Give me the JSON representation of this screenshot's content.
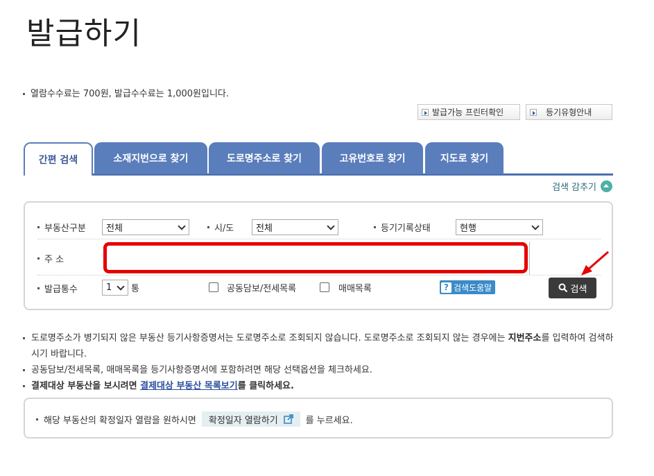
{
  "page": {
    "title": "발급하기"
  },
  "fee_note": "열람수수료는 700원, 발급수수료는 1,000원입니다.",
  "top_buttons": {
    "printer_check": "발급가능 프린터확인",
    "registry_type_guide": "등기유형안내"
  },
  "tabs": [
    {
      "label": "간편 검색",
      "active": true
    },
    {
      "label": "소재지번으로 찾기",
      "active": false
    },
    {
      "label": "도로명주소로 찾기",
      "active": false
    },
    {
      "label": "고유번호로 찾기",
      "active": false
    },
    {
      "label": "지도로 찾기",
      "active": false
    }
  ],
  "collapse_search": "검색 감추기",
  "form": {
    "property_type": {
      "label": "부동산구분",
      "value": "전체"
    },
    "region": {
      "label": "시/도",
      "value": "전체"
    },
    "record_status": {
      "label": "등기기록상태",
      "value": "현행"
    },
    "address": {
      "label": "주 소",
      "value": ""
    },
    "copies": {
      "label": "발급통수",
      "value": "1",
      "unit": "통"
    },
    "joint_collateral": {
      "label": "공동담보/전세목록",
      "checked": false
    },
    "sales_list": {
      "label": "매매목록",
      "checked": false
    },
    "help_button": "검색도움말",
    "search_button": "검색"
  },
  "notes": {
    "road_address_part1": "도로명주소가 병기되지 않은 부동산 등기사항증명서는 도로명주소로 조회되지 않습니다. 도로명주소로 조회되지 않는 경우에는",
    "road_address_bold": "지번주소",
    "road_address_part2": "를 입력하여 검색하시기 바랍니다.",
    "include_lists": "공동담보/전세목록, 매매목록을 등기사항증명서에 포함하려면 해당 선택옵션을 체크하세요.",
    "payment_prefix": "결제대상 부동산을 보시려면",
    "payment_link": "결제대상 부동산 목록보기",
    "payment_suffix": "를 클릭하세요."
  },
  "info_box": {
    "prefix": "해당 부동산의 확정일자 열람을 원하시면",
    "button": "확정일자 열람하기",
    "suffix": "를 누르세요."
  },
  "colors": {
    "tab_blue": "#5a7dbb",
    "highlight_red": "#e60000",
    "search_button": "#3a3a3a",
    "help_blue": "#3a8bc9"
  }
}
